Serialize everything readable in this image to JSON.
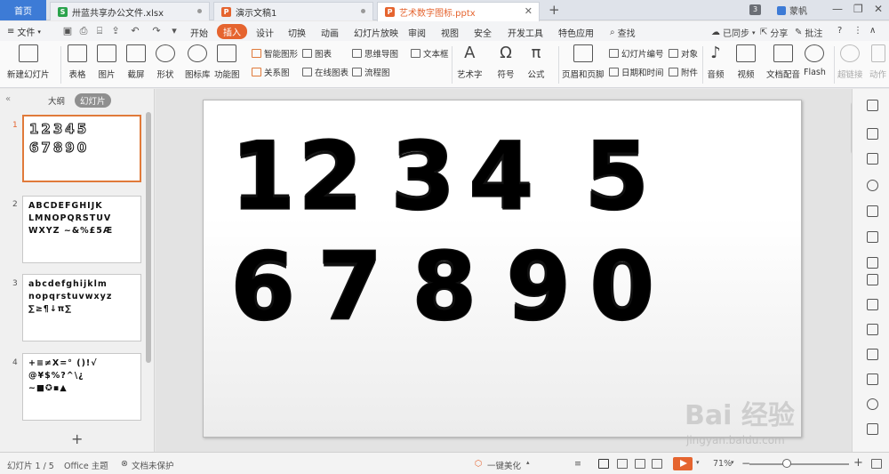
{
  "tabs": {
    "home": "首页",
    "docs": [
      {
        "label": "卅蓝共享办公文件.xlsx",
        "type": "xls"
      },
      {
        "label": "演示文稿1",
        "type": "ppt"
      },
      {
        "label": "艺术数字图标.pptx",
        "type": "ppt"
      }
    ],
    "add": "+",
    "badge": "3",
    "user": "蒙帆"
  },
  "menu": {
    "file": "文件",
    "items": [
      "开始",
      "插入",
      "设计",
      "切换",
      "动画",
      "幻灯片放映",
      "审阅",
      "视图",
      "安全",
      "开发工具",
      "特色应用"
    ],
    "active": "插入",
    "search": "查找",
    "sync": "已同步",
    "share": "分享",
    "comment": "批注",
    "help": "?"
  },
  "ribbon": {
    "new_slide": "新建幻灯片",
    "table": "表格",
    "picture": "图片",
    "screenshot": "截屏",
    "shape": "形状",
    "icon_lib": "图标库",
    "function_chart": "功能图",
    "smart_graphic": "智能图形",
    "chart": "图表",
    "relation_chart": "关系图",
    "online_chart": "在线图表",
    "mind_map": "思维导图",
    "flow_chart": "流程图",
    "text_box": "文本框",
    "art_text": "艺术字",
    "symbol": "符号",
    "formula": "公式",
    "header_footer": "页眉和页脚",
    "slide_number": "幻灯片编号",
    "object": "对象",
    "date_time": "日期和时间",
    "attachment": "附件",
    "audio": "音频",
    "video": "视频",
    "narration": "文档配音",
    "flash": "Flash",
    "hyperlink": "超链接",
    "action": "动作"
  },
  "panel": {
    "outline": "大纲",
    "slides": "幻灯片",
    "collapse": "«",
    "add": "+",
    "thumbs": [
      {
        "num": "1",
        "text": "12345\n67890"
      },
      {
        "num": "2",
        "text": "ABCDEFGHIJK\nLMNOPQRSTUV\nWXYZ ~&%£5Æ"
      },
      {
        "num": "3",
        "text": "abcdefghijklm\nnopqrstuvwxyz\n∑≥¶↓π∑"
      },
      {
        "num": "4",
        "text": "+≡≠X=° ()!√\n@¥$%?^\\¿\n~■✪▪▲"
      }
    ]
  },
  "slide": {
    "row1": [
      "1",
      "2",
      "3",
      "4",
      "5"
    ],
    "row2": [
      "6",
      "7",
      "8",
      "9",
      "0"
    ]
  },
  "status": {
    "slide_info": "幻灯片 1 / 5",
    "theme": "Office 主题",
    "protect": "文档未保护",
    "beautify": "一键美化",
    "zoom": "71%",
    "minus": "−",
    "plus": "+"
  },
  "watermark": {
    "brand": "Bai 经验",
    "url": "jingyan.baidu.com"
  },
  "colors": {
    "accent": "#e5642f",
    "home_tab": "#3d7bd6",
    "excel": "#2aa34c"
  }
}
